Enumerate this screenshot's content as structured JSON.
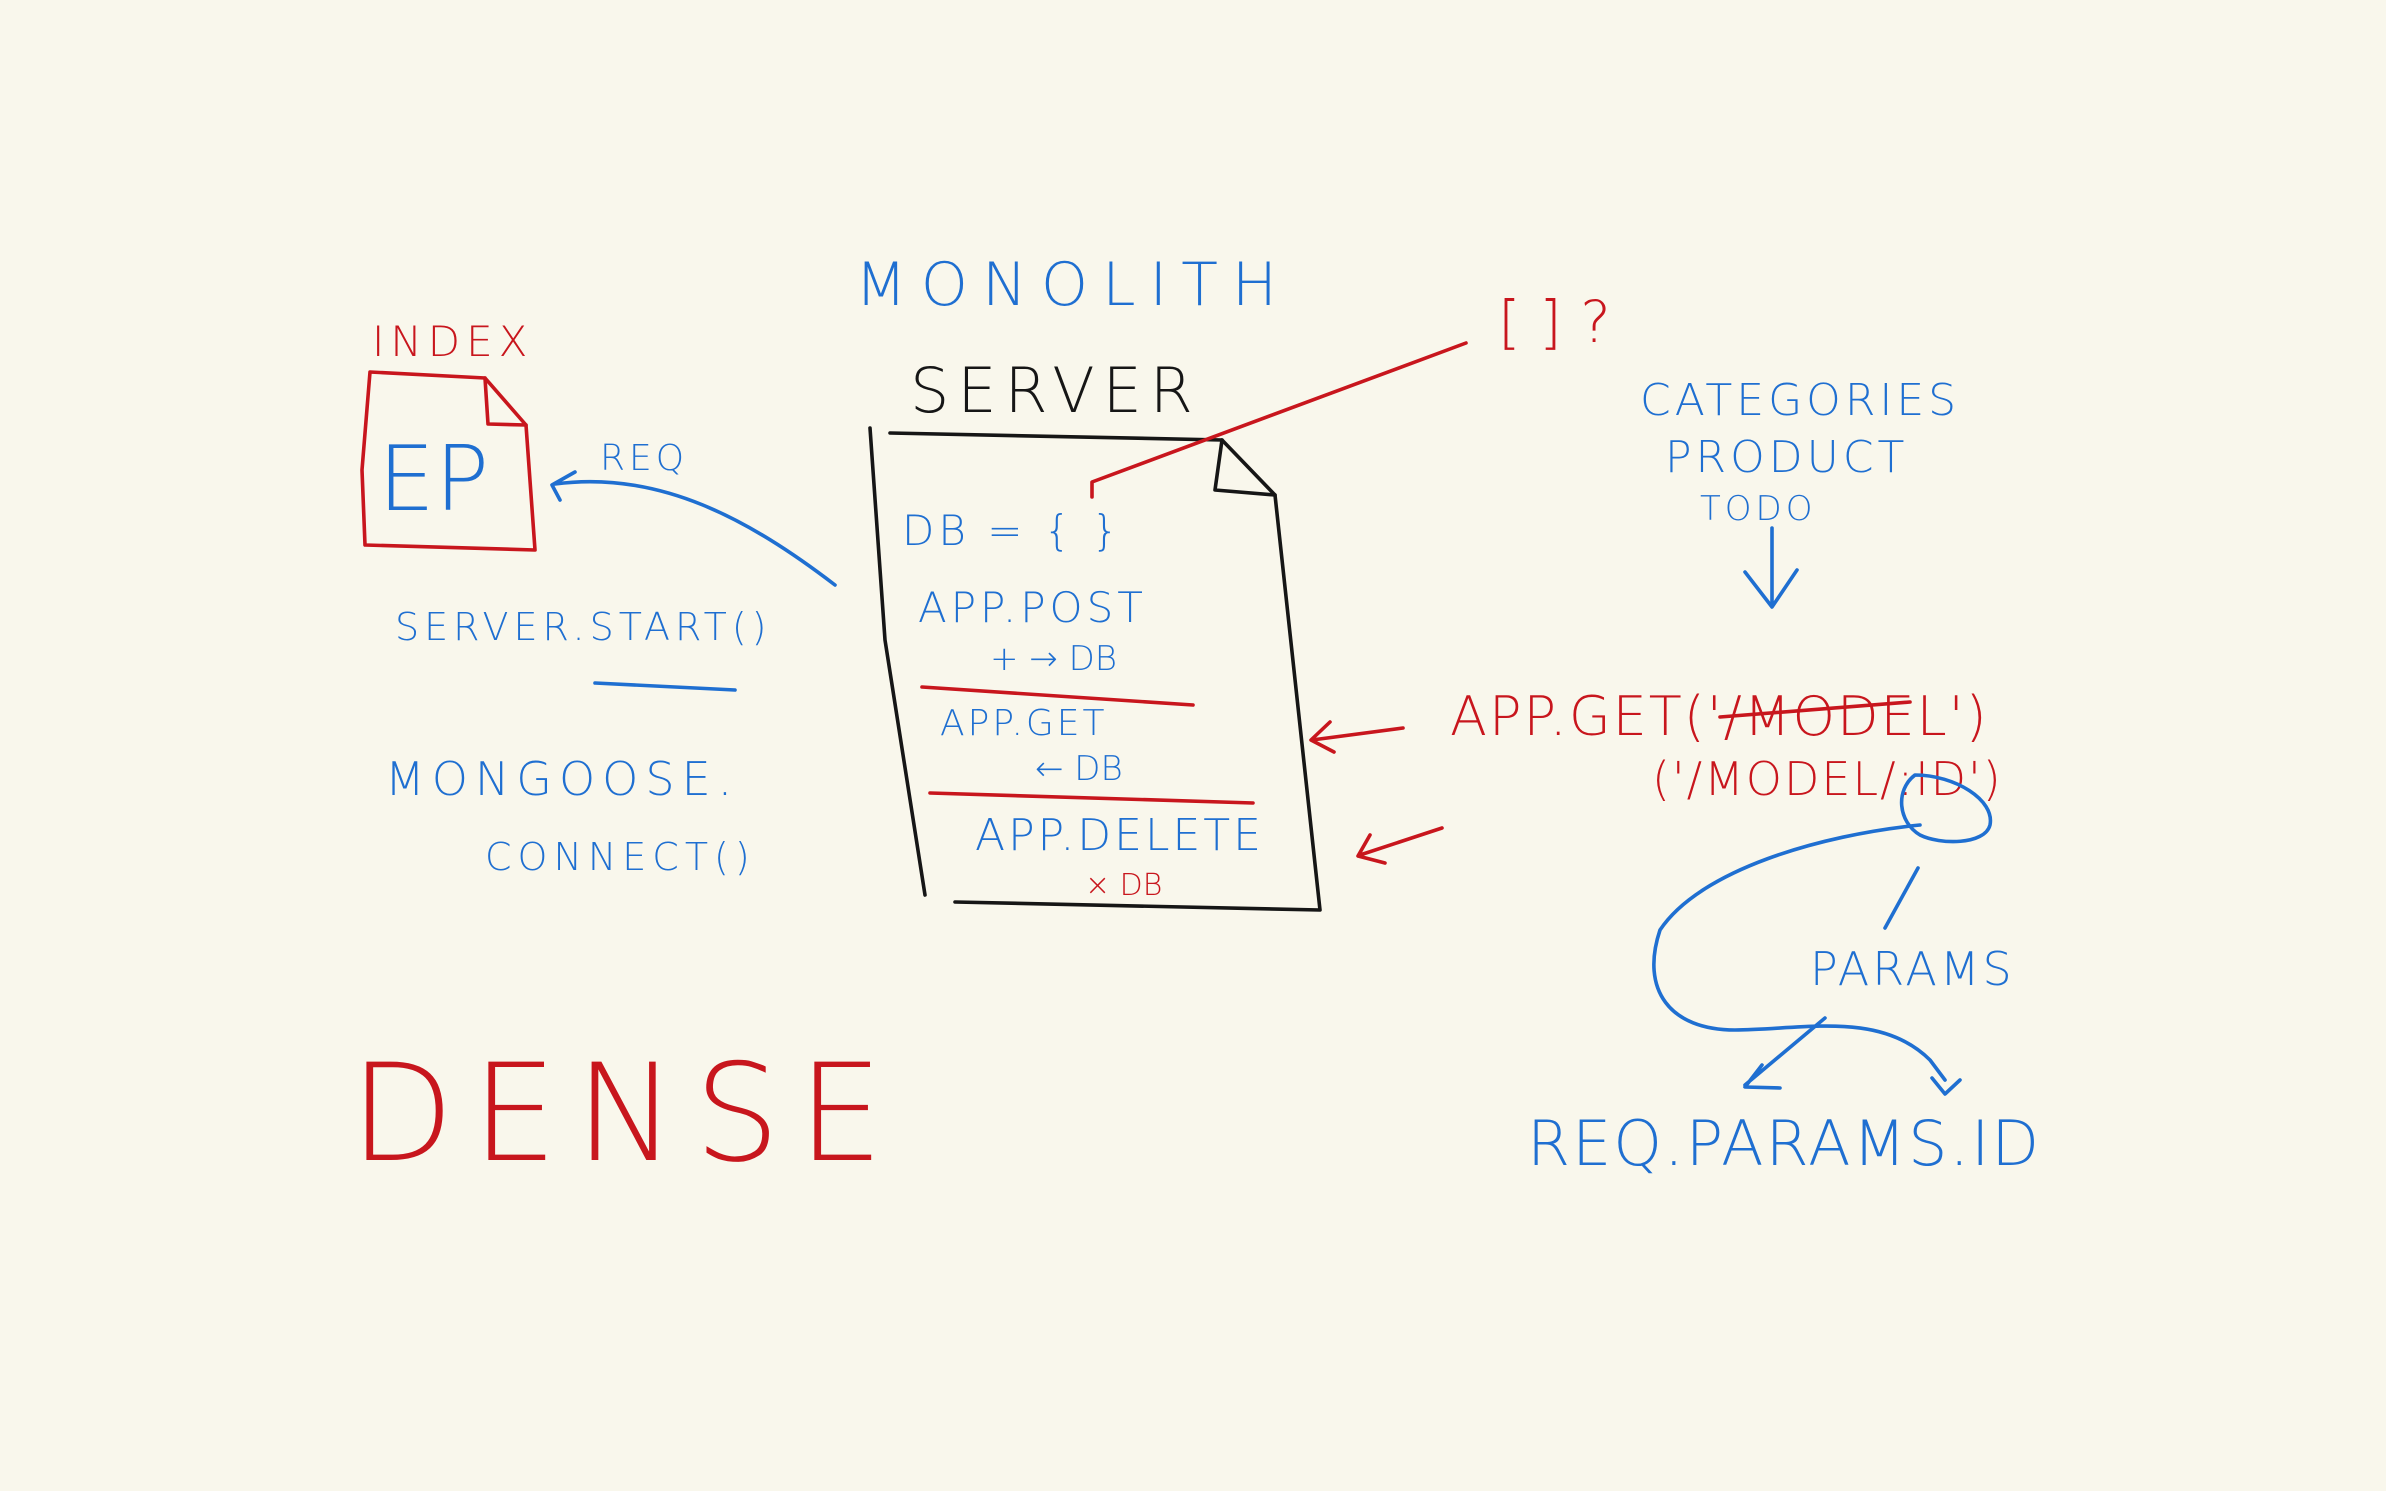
{
  "colors": {
    "background": "#f9f7ec",
    "blue_ink": "#1f6fd1",
    "red_ink": "#c8161d",
    "black_ink": "#161616"
  },
  "labels": {
    "monolith": "MONOLITH",
    "server": "SERVER",
    "index": "INDEX",
    "ep": "EP",
    "req": "REQ",
    "server_start": "SERVER.START()",
    "mongoose_line1": "MONGOOSE.",
    "mongoose_line2": "CONNECT()",
    "dense": "DENSE",
    "question": "[ ] ?",
    "categories": "CATEGORIES",
    "product": "PRODUCT",
    "todo": "TODO",
    "app_get_model": "APP.GET('/MODEL')",
    "model_id": "('/MODEL/:ID')",
    "params": "PARAMS",
    "req_params_id": "REQ.PARAMS.ID"
  },
  "server_doc": {
    "db_line": "DB = { }",
    "post_line": "APP.POST",
    "post_sub": "+ → DB",
    "get_line": "APP.GET",
    "get_sub": "← DB",
    "delete_line": "APP.DELETE",
    "delete_sub": "× DB"
  },
  "icons": {
    "index_file": "file-icon",
    "server_file": "document-icon"
  }
}
